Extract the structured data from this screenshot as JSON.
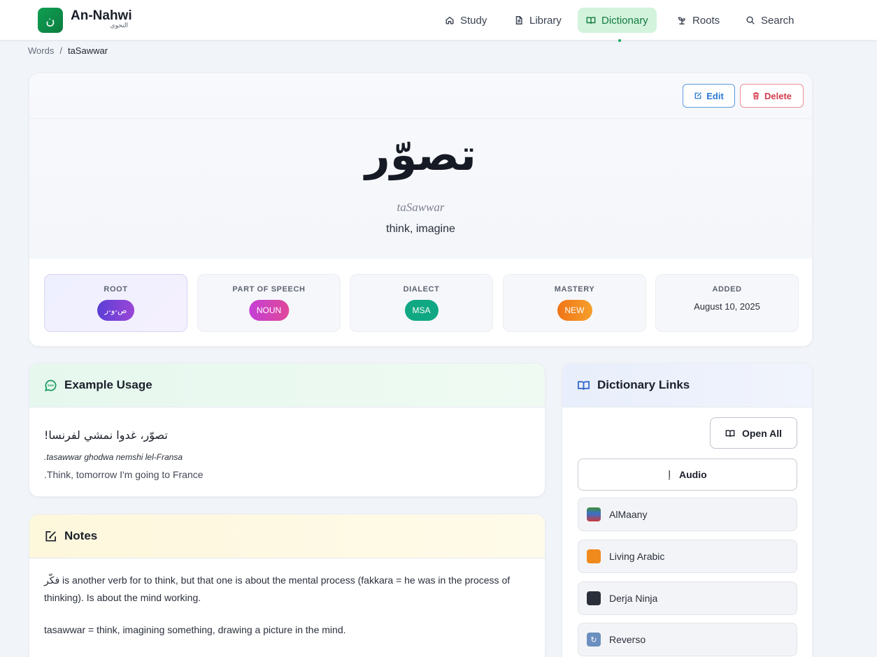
{
  "app": {
    "logo_glyph": "ن",
    "name": "An-Nahwi",
    "name_arabic": "النحوي"
  },
  "nav": {
    "items": [
      {
        "label": "Study",
        "icon": "home-icon"
      },
      {
        "label": "Library",
        "icon": "file-icon"
      },
      {
        "label": "Dictionary",
        "icon": "book-open-icon",
        "active": true
      },
      {
        "label": "Roots",
        "icon": "sprout-icon"
      },
      {
        "label": "Search",
        "icon": "search-icon"
      }
    ]
  },
  "breadcrumb": {
    "parent": "Words",
    "separator": "/",
    "current": "taSawwar"
  },
  "word": {
    "arabic": "تصوّر",
    "transliteration": "taSawwar",
    "meaning": "think, imagine",
    "edit_label": "Edit",
    "delete_label": "Delete"
  },
  "meta": {
    "root_label": "ROOT",
    "root_value": "ص-و-ر",
    "pos_label": "PART OF SPEECH",
    "pos_value": "NOUN",
    "dialect_label": "DIALECT",
    "dialect_value": "MSA",
    "mastery_label": "MASTERY",
    "mastery_value": "NEW",
    "added_label": "ADDED",
    "added_value": "August 10, 2025"
  },
  "example": {
    "title": "Example Usage",
    "arabic": "تصوّر، غدوا نمشي لفرنسا!",
    "transliteration": ".tasawwar ghodwa nemshi lel-Fransa",
    "english": ".Think, tomorrow I'm going to France"
  },
  "notes": {
    "title": "Notes",
    "para1_arabic": "فكّر",
    "para1_text": " is another verb for to think, but that one is about the mental process (fakkara = he was in the process of thinking). Is about the mind working.",
    "para2": "tasawwar = think, imagining something, drawing a picture in the mind."
  },
  "links": {
    "title": "Dictionary Links",
    "open_all_label": "Open All",
    "audio_glyph": "إ",
    "audio_label": "Audio",
    "items": [
      {
        "label": "AlMaany",
        "icon": "books-icon"
      },
      {
        "label": "Living Arabic",
        "icon": "orange-book-icon"
      },
      {
        "label": "Derja Ninja",
        "icon": "ninja-icon"
      },
      {
        "label": "Reverso",
        "icon": "reverso-icon"
      }
    ]
  },
  "colors": {
    "brand": "#0f9f52",
    "nav_active_bg": "#d3f3dd",
    "edit": "#2a78cf",
    "delete": "#d33b4c",
    "mastery_new": "#f07418",
    "dialect_msa": "#0fa882"
  }
}
